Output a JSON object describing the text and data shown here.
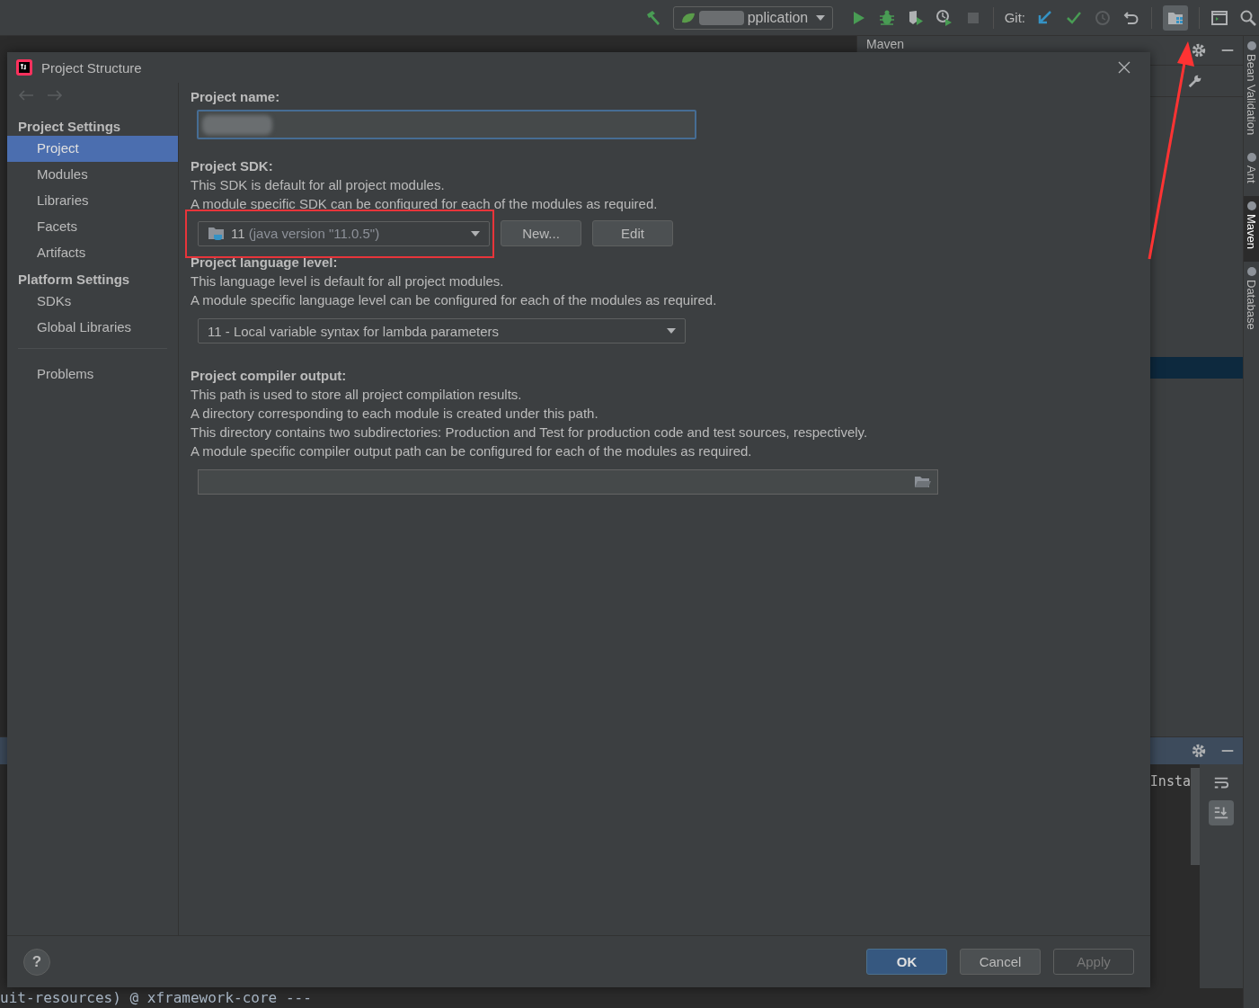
{
  "toolbar": {
    "run_config": "pplication",
    "git_label": "Git:",
    "project_structure_button": {
      "selected": true
    }
  },
  "maven_panel": {
    "title": "Maven"
  },
  "tool_windows": [
    {
      "label": "Bean Validation",
      "selected": false
    },
    {
      "label": "Ant",
      "selected": false
    },
    {
      "label": "Maven",
      "selected": true
    },
    {
      "label": "Database",
      "selected": false
    }
  ],
  "console": {
    "lines": [
      "Insta"
    ],
    "bottom_line": "uit-resources) @ xframework-core ---"
  },
  "dialog": {
    "title": "Project Structure",
    "sidebar": {
      "sections": [
        {
          "heading": "Project Settings",
          "items": [
            {
              "label": "Project",
              "selected": true
            },
            {
              "label": "Modules",
              "selected": false
            },
            {
              "label": "Libraries",
              "selected": false
            },
            {
              "label": "Facets",
              "selected": false
            },
            {
              "label": "Artifacts",
              "selected": false
            }
          ]
        },
        {
          "heading": "Platform Settings",
          "items": [
            {
              "label": "SDKs",
              "selected": false
            },
            {
              "label": "Global Libraries",
              "selected": false
            }
          ]
        }
      ],
      "footer_items": [
        {
          "label": "Problems",
          "selected": false
        }
      ]
    },
    "project_name": {
      "label": "Project name:"
    },
    "sdk": {
      "label": "Project SDK:",
      "lines": [
        "This SDK is default for all project modules.",
        "A module specific SDK can be configured for each of the modules as required."
      ],
      "value_number": "11",
      "value_detail": "(java version \"11.0.5\")",
      "buttons": [
        "New...",
        "Edit"
      ]
    },
    "language_level": {
      "label": "Project language level:",
      "lines": [
        "This language level is default for all project modules.",
        "A module specific language level can be configured for each of the modules as required."
      ],
      "value": "11 - Local variable syntax for lambda parameters"
    },
    "compiler_output": {
      "label": "Project compiler output:",
      "lines": [
        "This path is used to store all project compilation results.",
        "A directory corresponding to each module is created under this path.",
        "This directory contains two subdirectories: Production and Test for production code and test sources, respectively.",
        "A module specific compiler output path can be configured for each of the modules as required."
      ]
    },
    "help_label": "?",
    "buttons": [
      {
        "label": "OK",
        "kind": "primary",
        "disabled": false
      },
      {
        "label": "Cancel",
        "kind": "normal",
        "disabled": false
      },
      {
        "label": "Apply",
        "kind": "normal",
        "disabled": true
      }
    ]
  }
}
